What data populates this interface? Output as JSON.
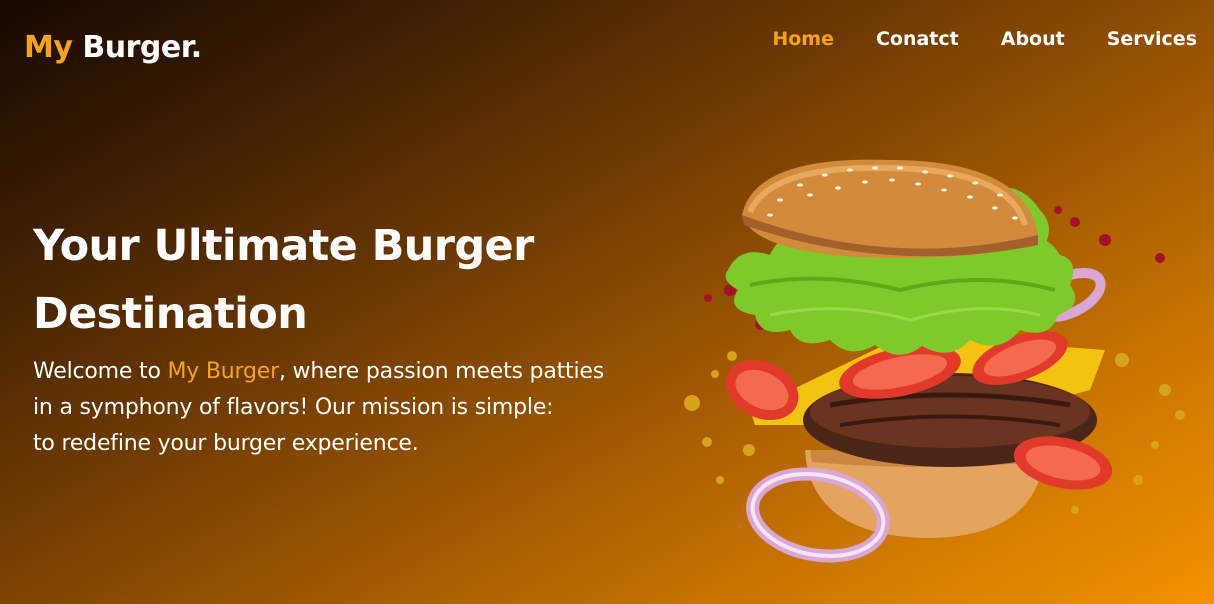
{
  "logo": {
    "accent": "My",
    "rest": " Burger."
  },
  "nav": {
    "items": [
      {
        "label": "Home",
        "active": true
      },
      {
        "label": "Conatct",
        "active": false
      },
      {
        "label": "About",
        "active": false
      },
      {
        "label": "Services",
        "active": false
      }
    ]
  },
  "hero": {
    "title_line1": "Your Ultimate Burger",
    "title_line2": "Destination",
    "desc_pre": "Welcome to ",
    "desc_brand": "My Burger",
    "desc_line1_post": ", where passion meets patties",
    "desc_line2": "in a symphony of flavors! Our mission is simple:",
    "desc_line3": "to redefine your burger experience."
  },
  "colors": {
    "accent": "#f7a21b",
    "gradient_start": "#160800",
    "gradient_end": "#f39200"
  }
}
